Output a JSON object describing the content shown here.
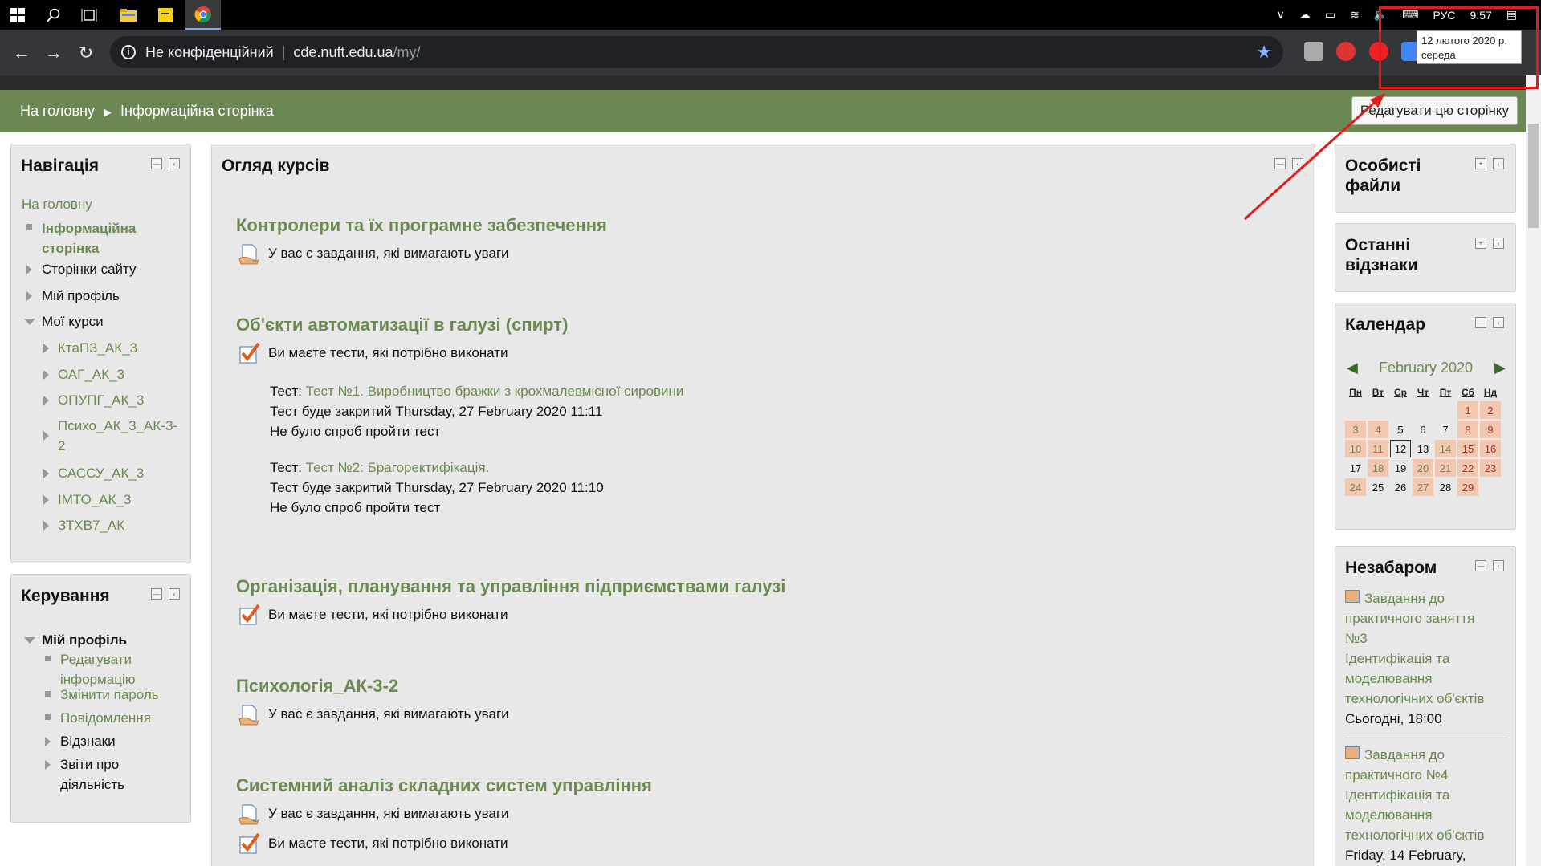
{
  "taskbar": {
    "tray": {
      "lang": "РУС",
      "time": "9:57"
    }
  },
  "tooltip": {
    "line1": "12 лютого 2020 р.",
    "line2": "середа"
  },
  "browser": {
    "security": "Не конфіденційний",
    "url_domain": "cde.nuft.edu.ua",
    "url_path": "/my/"
  },
  "breadcrumb": {
    "home": "На головну",
    "current": "Інформаційна сторінка"
  },
  "edit_page": "Редагувати цю сторінку",
  "navigation": {
    "title": "Навігація",
    "home": "На головну",
    "info_page_1": "Інформаційна",
    "info_page_2": "сторінка",
    "site_pages": "Сторінки сайту",
    "my_profile": "Мій профіль",
    "my_courses": "Мої курси",
    "courses": [
      "КтаПЗ_АК_3",
      "ОАГ_АК_3",
      "ОПУПГ_АК_3",
      "Психо_АК_3_АК-3-",
      "САССУ_АК_3",
      "ІМТО_АК_3",
      "ЗТХВ7_АК"
    ],
    "course_3_line2": "2"
  },
  "admin": {
    "title": "Керування",
    "my_profile": "Мій профіль",
    "edit_info_1": "Редагувати",
    "edit_info_2": "інформацію",
    "change_pass": "Змінити пароль",
    "messages": "Повідомлення",
    "grades": "Відзнаки",
    "reports_1": "Звіти про",
    "reports_2": "діяльність"
  },
  "main": {
    "title": "Огляд курсів",
    "courses": [
      {
        "title": "Контролери та їх програмне забезпечення",
        "note": "У вас є завдання, які вимагають уваги"
      },
      {
        "title": "Об'єкти автоматизації в галузі (спирт)",
        "note": "Ви маєте тести, які потрібно виконати"
      },
      {
        "title": "Організація, планування та управління підприємствами галузі",
        "note": "Ви маєте тести, які потрібно виконати"
      },
      {
        "title": "Психологія_АК-3-2",
        "note": "У вас є завдання, які вимагають уваги"
      },
      {
        "title": "Системний аналіз складних систем управління",
        "note": "У вас є завдання, які вимагають уваги",
        "note2": "Ви маєте тести, які потрібно виконати"
      }
    ],
    "tests": [
      {
        "prefix": "Тест:",
        "link": "Тест №1. Виробництво бражки з крохмалевмісної сировини",
        "closes": "Тест буде закритий Thursday, 27 February 2020 11:11",
        "attempts": "Не було спроб пройти тест"
      },
      {
        "prefix": "Тест:",
        "link": "Тест №2: Брагоректифікація.",
        "closes": "Тест буде закритий Thursday, 27 February 2020 11:10",
        "attempts": "Не було спроб пройти тест"
      }
    ]
  },
  "right": {
    "private_files_1": "Особисті",
    "private_files_2": "файли",
    "recent_1": "Останні",
    "recent_2": "відзнаки",
    "calendar_title": "Календар",
    "calendar_month": "February 2020",
    "weekdays": [
      "Пн",
      "Вт",
      "Ср",
      "Чт",
      "Пт",
      "Сб",
      "Нд"
    ],
    "upcoming_title": "Незабаром",
    "upcoming": [
      {
        "lines": [
          "Завдання до",
          "практичного заняття",
          "№3",
          "Ідентифікація та",
          "моделювання",
          "технологічних об'єктів"
        ],
        "when": "Сьогодні",
        "time": ", 18:00"
      },
      {
        "lines": [
          "Завдання до",
          "практичного №4",
          "Ідентифікація та",
          "моделювання",
          "технологічних об'єктів"
        ],
        "when": "Friday, 14 February,",
        "time": ""
      }
    ]
  },
  "colors": {
    "accent_green": "#6b8a4f",
    "header_green": "#6b8753",
    "highlight_red": "#e31b1b"
  }
}
